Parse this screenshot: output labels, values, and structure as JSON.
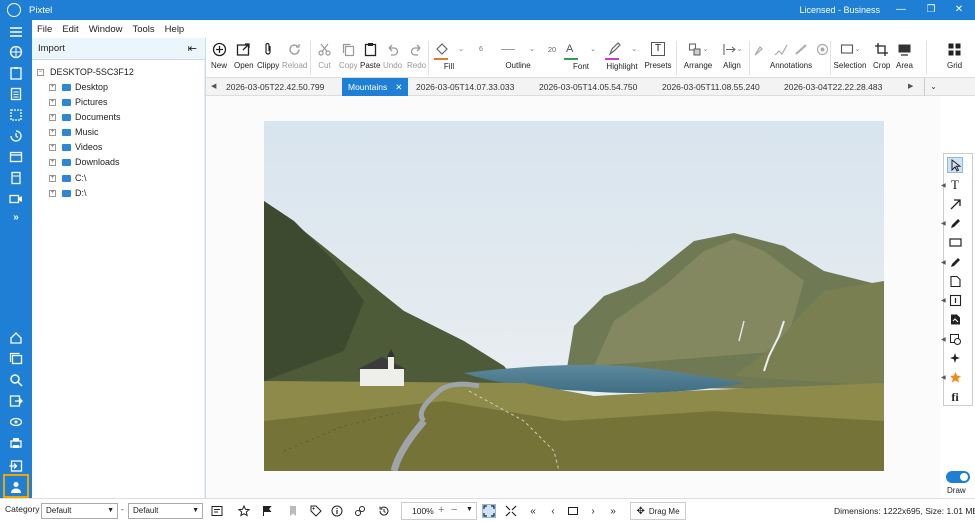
{
  "app": {
    "title": "Pixtel",
    "license": "Licensed - Business"
  },
  "window_buttons": {
    "minimize": "—",
    "restore": "❐",
    "close": "✕"
  },
  "menu": [
    "File",
    "Edit",
    "Window",
    "Tools",
    "Help"
  ],
  "panel": {
    "title": "Import"
  },
  "tree": {
    "root": "DESKTOP-5SC3F12",
    "items": [
      "Desktop",
      "Pictures",
      "Documents",
      "Music",
      "Videos",
      "Downloads",
      "C:\\",
      "D:\\"
    ]
  },
  "toolbar": {
    "new": "New",
    "open": "Open",
    "clippy": "Clippy",
    "reload": "Reload",
    "cut": "Cut",
    "copy": "Copy",
    "paste": "Paste",
    "undo": "Undo",
    "redo": "Redo",
    "fill": "Fill",
    "outline": "Outline",
    "outline_width": "6",
    "font_size": "20",
    "font": "Font",
    "highlight": "Highlight",
    "presets": "Presets",
    "arrange": "Arrange",
    "align": "Align",
    "annotations": "Annotations",
    "selection": "Selection",
    "crop": "Crop",
    "area": "Area",
    "grid": "Grid"
  },
  "tabs": [
    {
      "label": "2026-03-05T22.42.50.799"
    },
    {
      "label": "Mountains",
      "active": true
    },
    {
      "label": "2026-03-05T14.07.33.033"
    },
    {
      "label": "2026-03-05T14.05.54.750"
    },
    {
      "label": "2026-03-05T11.08.55.240"
    },
    {
      "label": "2026-03-04T22.22.28.483"
    }
  ],
  "right_panel": {
    "draw_label": "Draw"
  },
  "status": {
    "category_label": "Category",
    "category_value": "Default",
    "dash": "-",
    "subcategory_value": "Default",
    "zoom": "100%",
    "drag_label": "Drag Me",
    "dimensions": "Dimensions: 1222x695, Size: 1.01 MB"
  },
  "colors": {
    "accent": "#1f7fd4",
    "fill_swatch": "#e07b2a",
    "font_swatch": "#2e9e4f",
    "highlight_swatch": "#c040c0",
    "active_outline": "#f0a500"
  }
}
